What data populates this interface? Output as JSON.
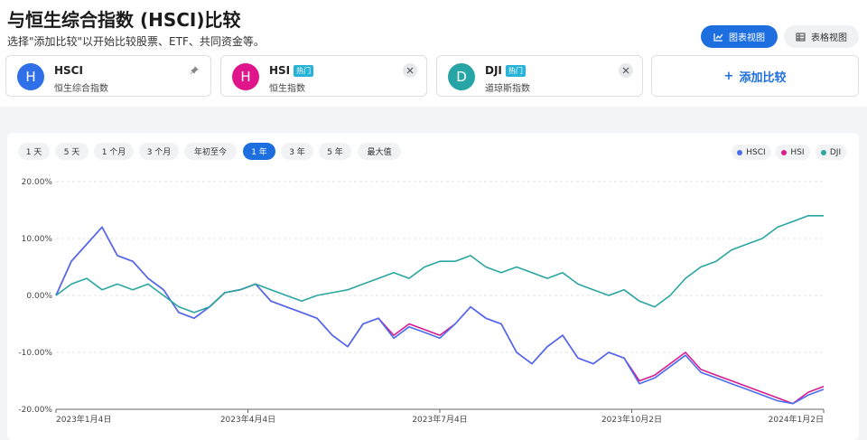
{
  "header": {
    "title": "与恒生综合指数 (HSCI)比较",
    "subtitle": "选择\"添加比较\"以开始比较股票、ETF、共同资金等。",
    "chart_view_label": "图表视图",
    "table_view_label": "表格视图"
  },
  "cards": [
    {
      "avatar": "H",
      "symbol": "HSCI",
      "name": "恒生综合指数",
      "hot": "",
      "color": "#2f6fe8"
    },
    {
      "avatar": "H",
      "symbol": "HSI",
      "name": "恒生指数",
      "hot": "热门",
      "color": "#e0158c"
    },
    {
      "avatar": "D",
      "symbol": "DJI",
      "name": "道琼斯指数",
      "hot": "热门",
      "color": "#26a4a6"
    }
  ],
  "add_compare_label": "添加比较",
  "ranges": [
    "1 天",
    "5 天",
    "1 个月",
    "3 个月",
    "年初至今",
    "1 年",
    "3 年",
    "5 年",
    "最大值"
  ],
  "active_range": "1 年",
  "legend": [
    {
      "name": "HSCI",
      "color": "#4a6df0"
    },
    {
      "name": "HSI",
      "color": "#d81b8f"
    },
    {
      "name": "DJI",
      "color": "#2aa6a0"
    }
  ],
  "chart_data": {
    "type": "line",
    "y_ticks": [
      "20.00%",
      "10.00%",
      "0.00%",
      "-10.00%",
      "-20.00%"
    ],
    "x_ticks": [
      "2023年1月4日",
      "2023年4月4日",
      "2023年7月4日",
      "2023年10月2日",
      "2024年1月2日"
    ],
    "ylim": [
      -20,
      20
    ],
    "grid": true,
    "series": [
      {
        "name": "HSI",
        "color": "#d81b8f",
        "x": [
          0,
          2,
          4,
          6,
          8,
          10,
          12,
          14,
          16,
          18,
          20,
          22,
          24,
          26,
          28,
          30,
          32,
          34,
          36,
          38,
          40,
          42,
          44,
          46,
          48,
          50,
          52,
          54,
          56,
          58,
          60,
          62,
          64,
          66,
          68,
          70,
          72,
          74,
          76,
          78,
          80,
          82,
          84,
          86,
          88,
          90,
          92,
          94,
          96,
          98,
          100
        ],
        "values": [
          0,
          6,
          9,
          12,
          7,
          6,
          3,
          1,
          -3,
          -4,
          -2,
          0.5,
          1,
          2,
          -1,
          -2,
          -3,
          -4,
          -7,
          -9,
          -5,
          -4,
          -7,
          -5,
          -6,
          -7,
          -5,
          -2,
          -4,
          -5,
          -10,
          -12,
          -9,
          -7,
          -11,
          -12,
          -10,
          -11,
          -15,
          -14,
          -12,
          -10,
          -13,
          -14,
          -15,
          -16,
          -17,
          -18,
          -19,
          -17,
          -16
        ]
      },
      {
        "name": "HSCI",
        "color": "#4a6df0",
        "x": [
          0,
          2,
          4,
          6,
          8,
          10,
          12,
          14,
          16,
          18,
          20,
          22,
          24,
          26,
          28,
          30,
          32,
          34,
          36,
          38,
          40,
          42,
          44,
          46,
          48,
          50,
          52,
          54,
          56,
          58,
          60,
          62,
          64,
          66,
          68,
          70,
          72,
          74,
          76,
          78,
          80,
          82,
          84,
          86,
          88,
          90,
          92,
          94,
          96,
          98,
          100
        ],
        "values": [
          0,
          6,
          9,
          12,
          7,
          6,
          3,
          1,
          -3,
          -4,
          -2,
          0.5,
          1,
          2,
          -1,
          -2,
          -3,
          -4,
          -7,
          -9,
          -5,
          -4,
          -7.5,
          -5.5,
          -6.5,
          -7.5,
          -5,
          -2,
          -4,
          -5,
          -10,
          -12,
          -9,
          -7,
          -11,
          -12,
          -10,
          -11,
          -15.5,
          -14.5,
          -12.5,
          -10.5,
          -13.5,
          -14.5,
          -15.5,
          -16.5,
          -17.5,
          -18.5,
          -19,
          -17.5,
          -16.5
        ]
      },
      {
        "name": "DJI",
        "color": "#2aa6a0",
        "x": [
          0,
          2,
          4,
          6,
          8,
          10,
          12,
          14,
          16,
          18,
          20,
          22,
          24,
          26,
          28,
          30,
          32,
          34,
          36,
          38,
          40,
          42,
          44,
          46,
          48,
          50,
          52,
          54,
          56,
          58,
          60,
          62,
          64,
          66,
          68,
          70,
          72,
          74,
          76,
          78,
          80,
          82,
          84,
          86,
          88,
          90,
          92,
          94,
          96,
          98,
          100
        ],
        "values": [
          0,
          2,
          3,
          1,
          2,
          1,
          2,
          0,
          -2,
          -3,
          -2,
          0.5,
          1,
          2,
          1,
          0,
          -1,
          0,
          0.5,
          1,
          2,
          3,
          4,
          3,
          5,
          6,
          6,
          7,
          5,
          4,
          5,
          4,
          3,
          4,
          2,
          1,
          0,
          1,
          -1,
          -2,
          0,
          3,
          5,
          6,
          8,
          9,
          10,
          12,
          13,
          14,
          14
        ]
      }
    ]
  }
}
